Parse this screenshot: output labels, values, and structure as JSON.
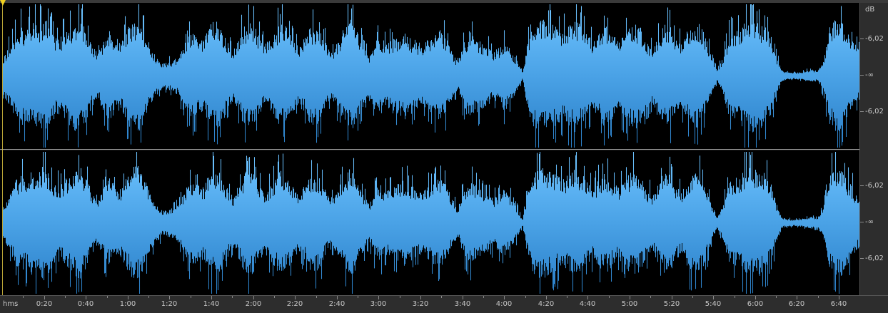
{
  "timeline": {
    "unit_label": "hms",
    "ticks": [
      "0:20",
      "0:40",
      "1:00",
      "1:20",
      "1:40",
      "2:00",
      "2:20",
      "2:40",
      "3:00",
      "3:20",
      "3:40",
      "4:00",
      "4:20",
      "4:40",
      "5:00",
      "5:20",
      "5:40",
      "6:00",
      "6:20",
      "6:40"
    ]
  },
  "db_ruler": {
    "unit_label": "dB",
    "top_channel": [
      "-6,02",
      "-∞",
      "-6,02"
    ],
    "bottom_channel": [
      "-6,02",
      "-∞",
      "-6,02"
    ]
  },
  "colors": {
    "waveform_light": "#6ec3ff",
    "waveform_dark": "#2a7fc8",
    "background": "#000000",
    "ruler_bg": "#2d2d2d",
    "playhead": "#f0d020"
  },
  "waveform_envelope": [
    0.3,
    0.45,
    0.65,
    0.78,
    0.72,
    0.85,
    0.8,
    0.92,
    0.78,
    0.6,
    0.62,
    0.75,
    0.85,
    0.9,
    0.72,
    0.5,
    0.35,
    0.55,
    0.7,
    0.6,
    0.55,
    0.75,
    0.88,
    0.92,
    0.7,
    0.45,
    0.3,
    0.2,
    0.22,
    0.25,
    0.35,
    0.55,
    0.7,
    0.6,
    0.58,
    0.8,
    0.88,
    0.75,
    0.55,
    0.4,
    0.62,
    0.8,
    0.85,
    0.7,
    0.5,
    0.55,
    0.7,
    0.82,
    0.78,
    0.6,
    0.45,
    0.58,
    0.75,
    0.8,
    0.65,
    0.45,
    0.4,
    0.6,
    0.8,
    0.88,
    0.7,
    0.48,
    0.3,
    0.55,
    0.6,
    0.5,
    0.58,
    0.62,
    0.68,
    0.6,
    0.55,
    0.5,
    0.58,
    0.65,
    0.72,
    0.62,
    0.4,
    0.22,
    0.5,
    0.7,
    0.6,
    0.52,
    0.48,
    0.38,
    0.45,
    0.55,
    0.4,
    0.25,
    0.05,
    0.6,
    0.82,
    0.9,
    0.88,
    0.8,
    0.75,
    0.7,
    0.82,
    0.88,
    0.8,
    0.65,
    0.55,
    0.7,
    0.8,
    0.72,
    0.58,
    0.62,
    0.78,
    0.85,
    0.75,
    0.55,
    0.45,
    0.65,
    0.8,
    0.78,
    0.6,
    0.5,
    0.72,
    0.85,
    0.8,
    0.62,
    0.3,
    0.08,
    0.3,
    0.65,
    0.72,
    0.78,
    0.85,
    0.88,
    0.85,
    0.78,
    0.65,
    0.3,
    0.08,
    0.06,
    0.05,
    0.06,
    0.08,
    0.1,
    0.08,
    0.25,
    0.75,
    0.9,
    0.85,
    0.7,
    0.55,
    0.4
  ]
}
